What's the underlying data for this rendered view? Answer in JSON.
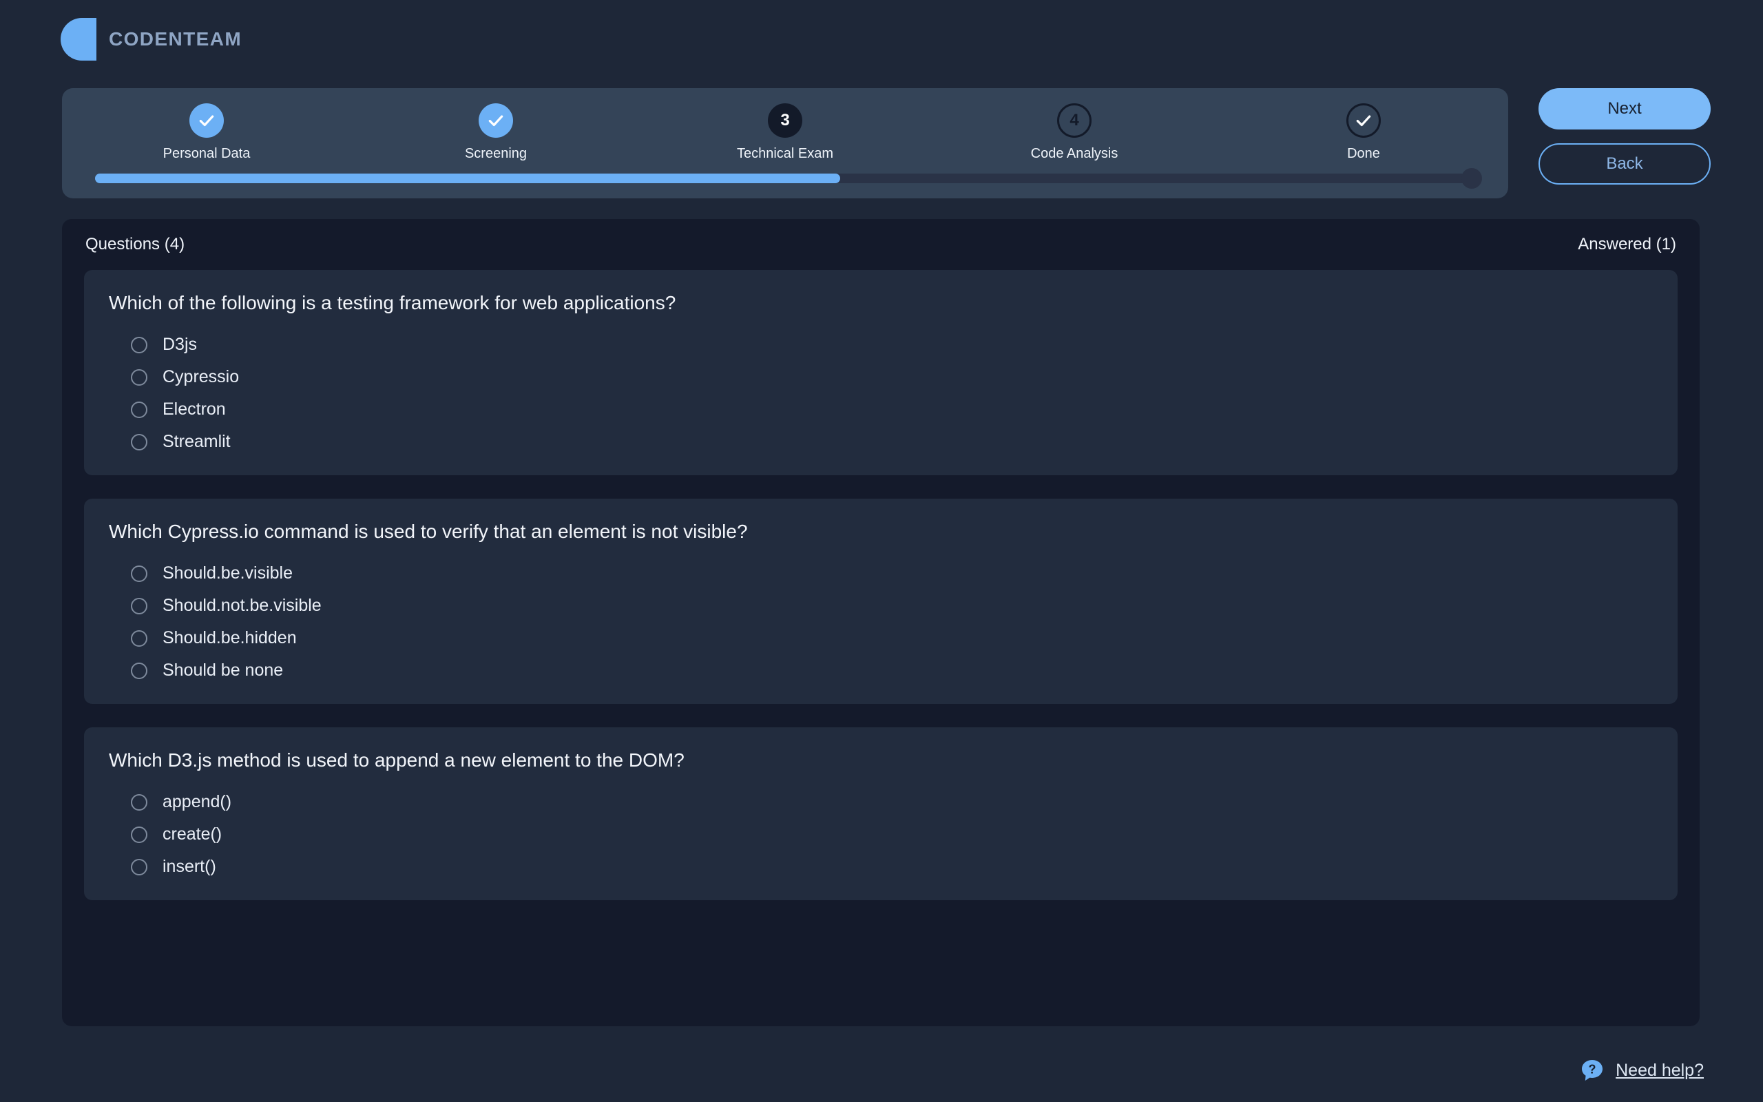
{
  "brand": {
    "name": "CODENTEAM",
    "logo_icon": "half-circle-logo-icon",
    "accent_color": "#6cb0f5"
  },
  "stepper": {
    "steps": [
      {
        "label": "Personal Data",
        "state": "done",
        "marker": "check"
      },
      {
        "label": "Screening",
        "state": "done",
        "marker": "check"
      },
      {
        "label": "Technical Exam",
        "state": "current",
        "marker": "3"
      },
      {
        "label": "Code Analysis",
        "state": "pending",
        "marker": "4"
      },
      {
        "label": "Done",
        "state": "pending",
        "marker": "check"
      }
    ],
    "progress_percent": 54
  },
  "nav": {
    "next_label": "Next",
    "back_label": "Back"
  },
  "questions_panel": {
    "header": {
      "questions_count_label": "Questions (4)",
      "answered_count_label": "Answered (1)"
    },
    "questions": [
      {
        "title": "Which of the following is a testing framework for web applications?",
        "options": [
          "D3js",
          "Cypressio",
          "Electron",
          "Streamlit"
        ]
      },
      {
        "title": "Which Cypress.io command is used to verify that an element is not visible?",
        "options": [
          "Should.be.visible",
          "Should.not.be.visible",
          "Should.be.hidden",
          "Should be none"
        ]
      },
      {
        "title": "Which D3.js method is used to append a new element to the DOM?",
        "options": [
          "append()",
          "create()",
          "insert()"
        ]
      }
    ]
  },
  "footer": {
    "help_icon": "question-bubble-icon",
    "help_label": "Need help?"
  }
}
